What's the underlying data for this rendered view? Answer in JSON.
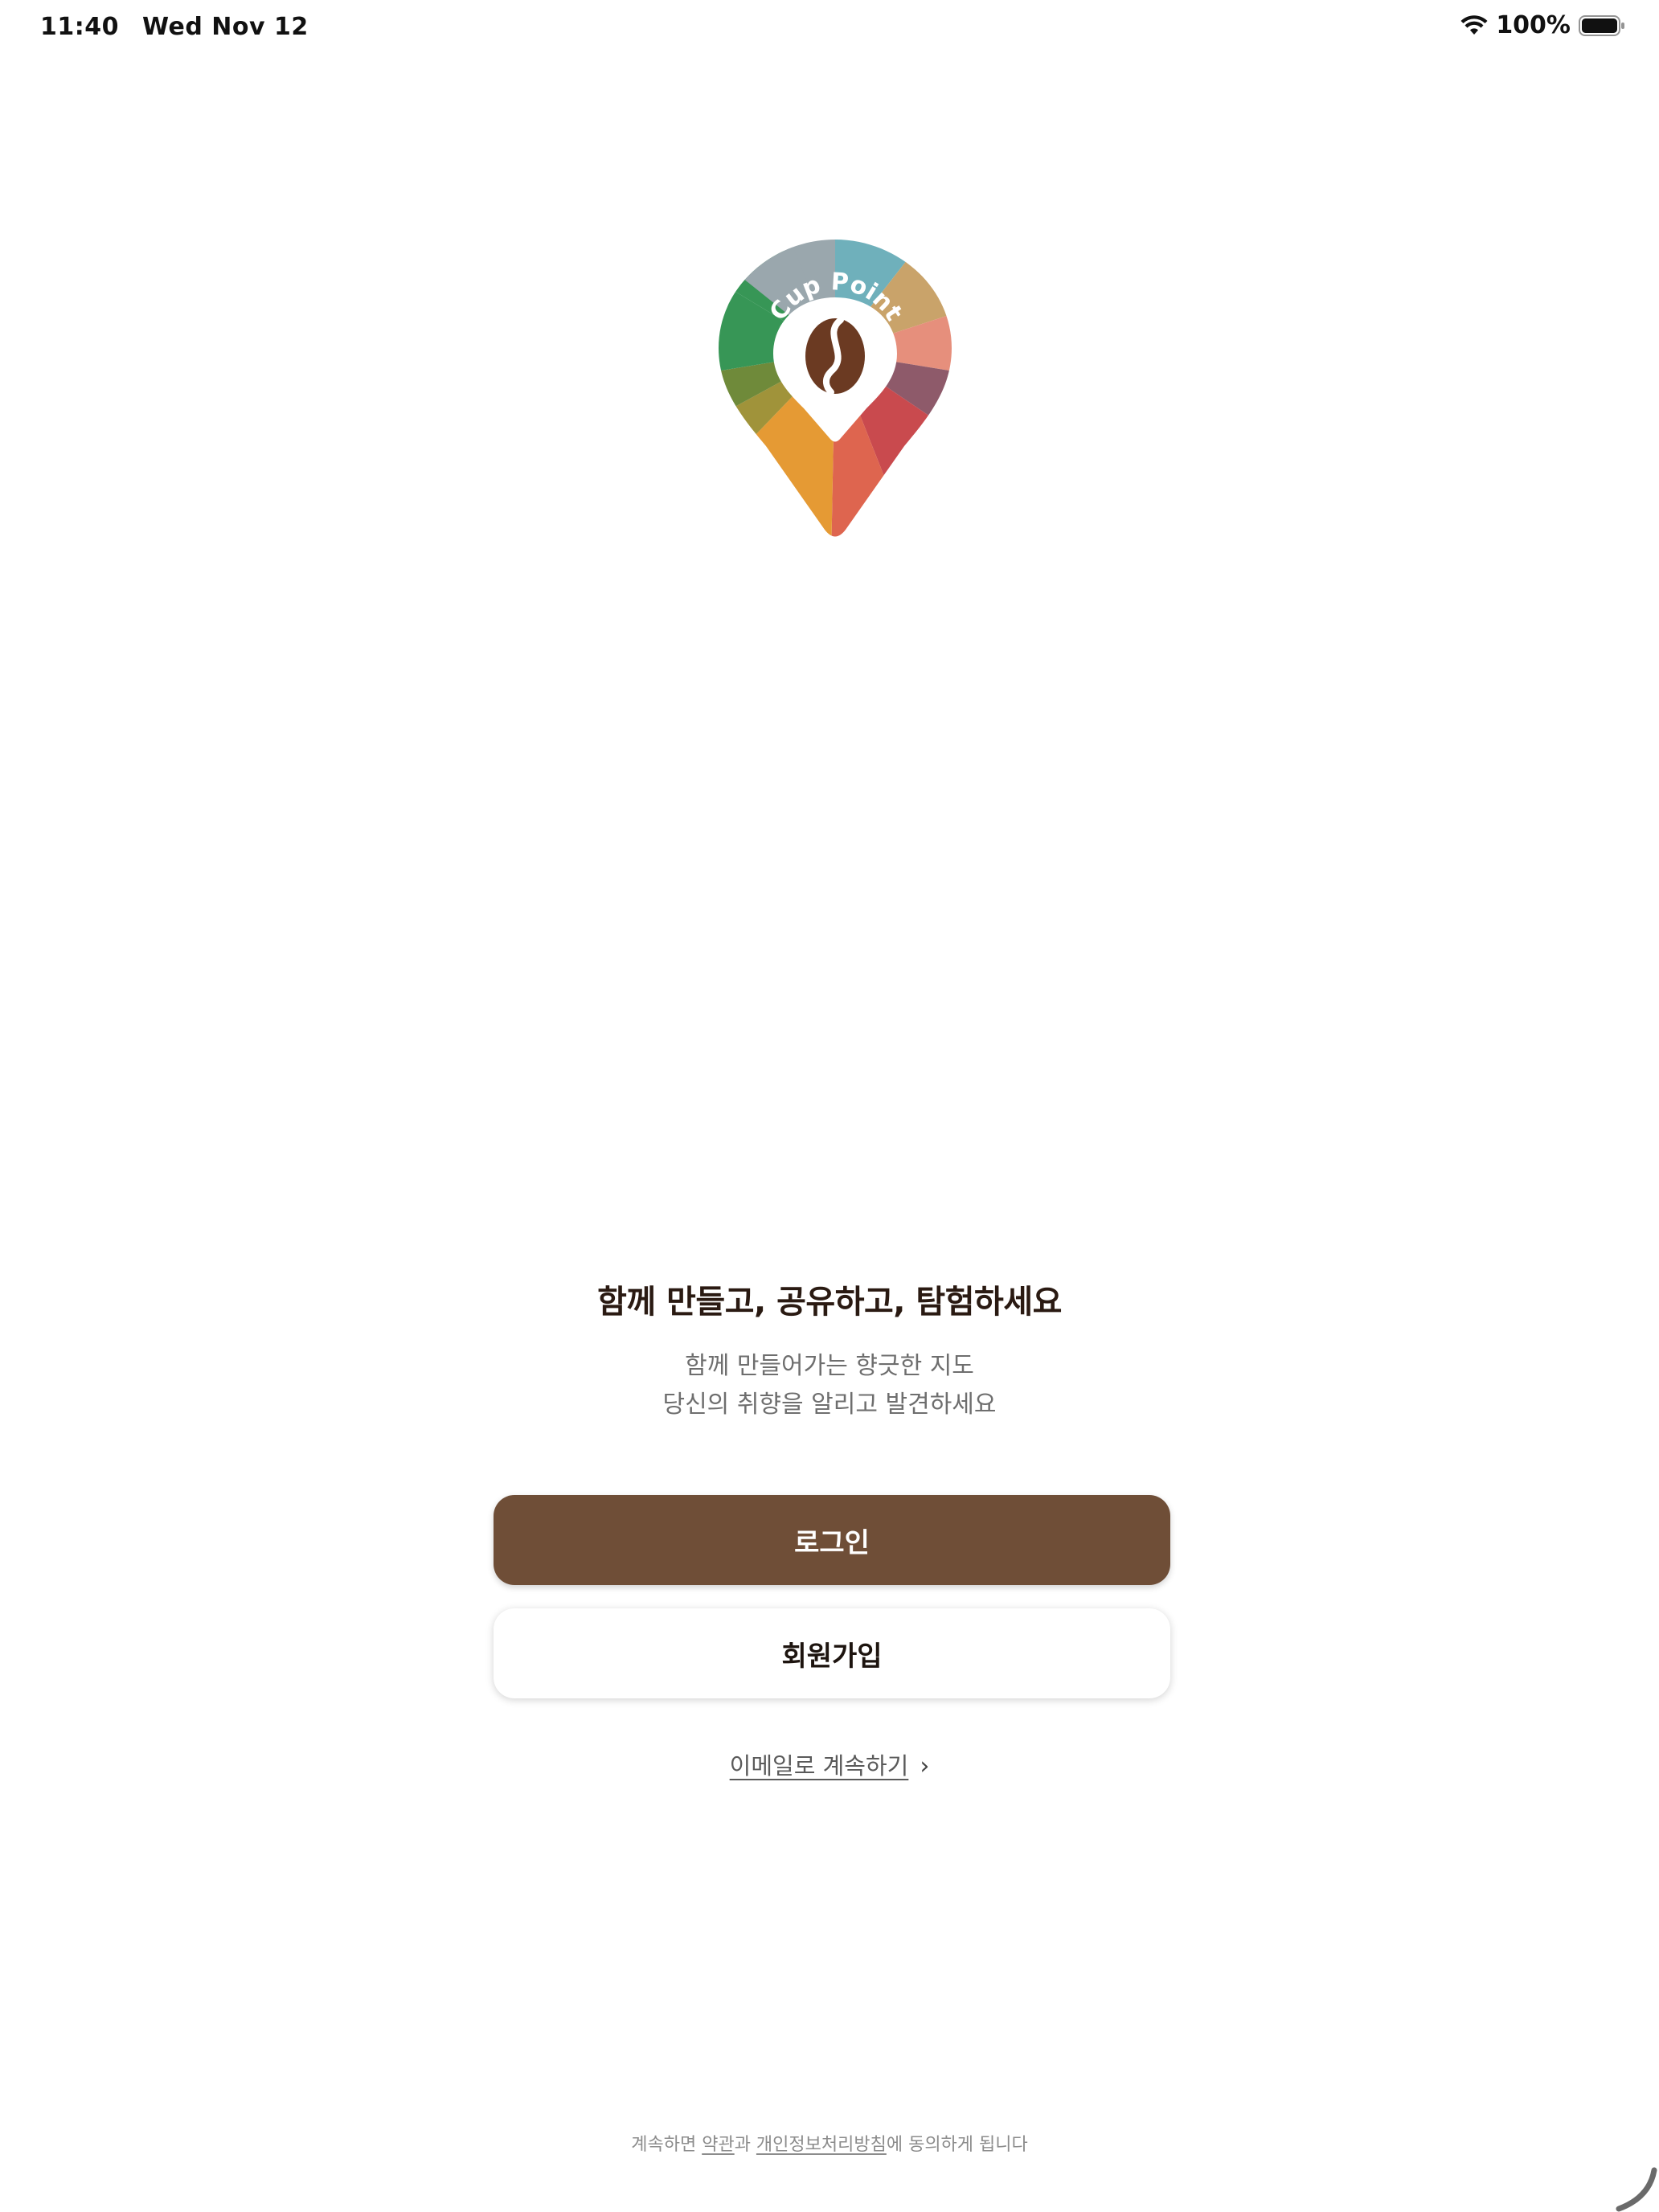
{
  "status_bar": {
    "time": "11:40",
    "date": "Wed Nov 12",
    "battery": "100%",
    "icons": [
      "wifi-icon",
      "battery-icon"
    ]
  },
  "logo": {
    "text": "Cup Point",
    "icon": "coffee-bean-pin-icon",
    "colors": {
      "bean": "#6b3a22",
      "teal": "#6fb0bb",
      "tan": "#c9a36a",
      "salmon": "#e68f7c",
      "mauve": "#8e5a6a",
      "red": "#c94a4e",
      "coral": "#de654f",
      "orange": "#e59a34",
      "olive": "#a0933a",
      "moss": "#6f8a3a",
      "green": "#379656",
      "gray": "#9aa7ad"
    }
  },
  "main": {
    "headline": "함께 만들고, 공유하고, 탐험하세요",
    "subtitle_line1": "함께 만들어가는 향긋한 지도",
    "subtitle_line2": "당신의 취향을 알리고 발견하세요"
  },
  "buttons": {
    "login_label": "로그인",
    "signup_label": "회원가입",
    "email_label": "이메일로 계속하기",
    "email_icon": "chevron-right-icon"
  },
  "footer": {
    "prefix": "계속하면 ",
    "terms": "약관",
    "middle": "과 ",
    "privacy": "개인정보처리방침",
    "suffix": "에 동의하게 됩니다"
  },
  "theme": {
    "primary": "#6f4e37",
    "text_dark": "#2a1a12",
    "text_muted": "#6e6e6e"
  }
}
